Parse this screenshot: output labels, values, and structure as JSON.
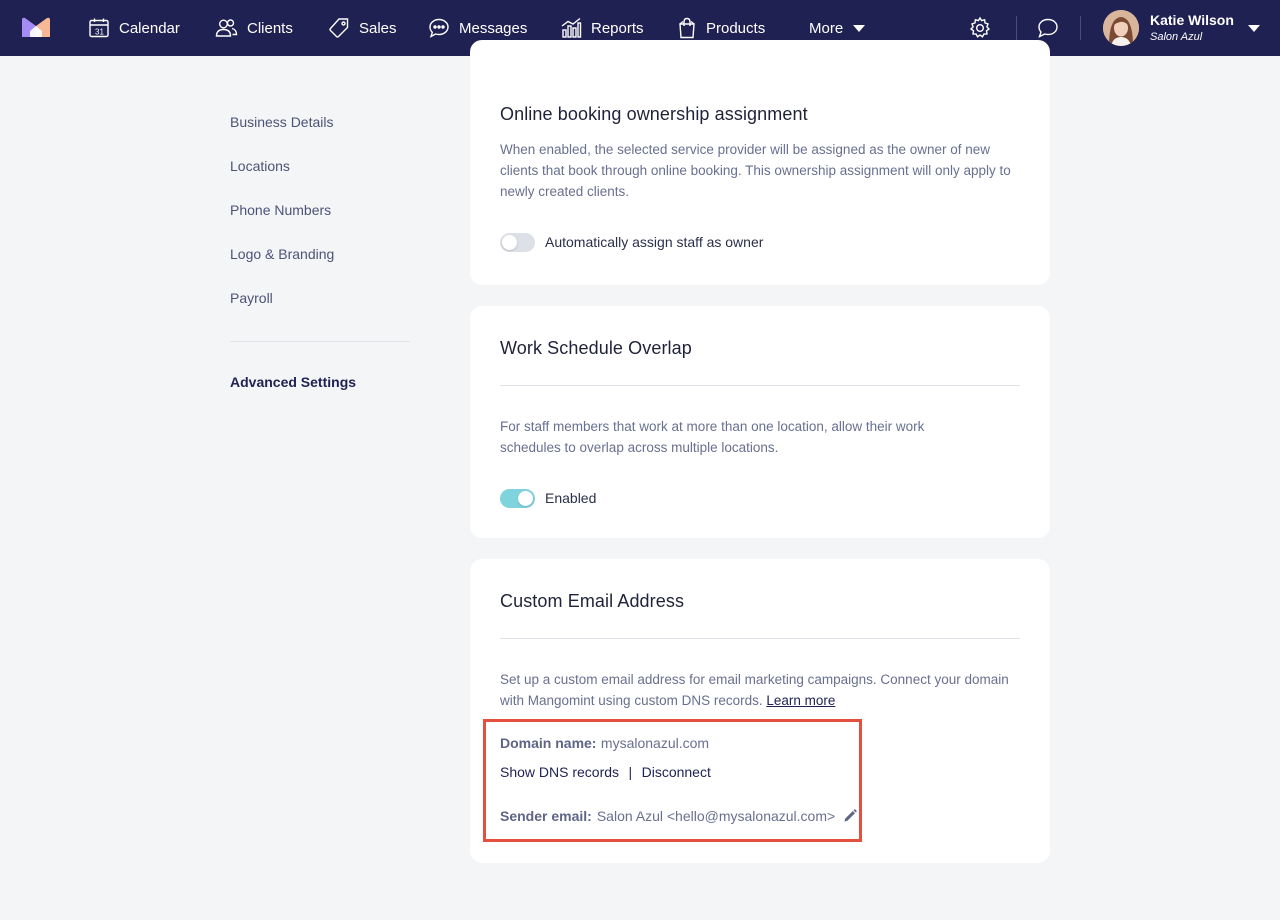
{
  "nav": {
    "items": [
      {
        "label": "Calendar",
        "icon": "calendar-icon"
      },
      {
        "label": "Clients",
        "icon": "clients-icon"
      },
      {
        "label": "Sales",
        "icon": "tag-icon"
      },
      {
        "label": "Messages",
        "icon": "chat-bubble-icon"
      },
      {
        "label": "Reports",
        "icon": "bar-chart-icon"
      },
      {
        "label": "Products",
        "icon": "shopping-bag-icon"
      }
    ],
    "more_label": "More",
    "user": {
      "name": "Katie Wilson",
      "salon": "Salon Azul"
    },
    "brand_colors": {
      "nav_bg": "#1f2152",
      "logo_purple": "#a58cf5",
      "logo_peach": "#f7b896"
    }
  },
  "sidebar": {
    "items": [
      "Business Details",
      "Locations",
      "Phone Numbers",
      "Logo & Branding",
      "Payroll"
    ],
    "active": "Advanced Settings"
  },
  "booking_ownership": {
    "title": "Online booking ownership assignment",
    "description": "When enabled, the selected service provider will be assigned as the owner of new clients that book through online booking. This ownership assignment will only apply to newly created clients.",
    "toggle_label": "Automatically assign staff as owner",
    "toggle_on": false
  },
  "work_schedule": {
    "title": "Work Schedule Overlap",
    "description": "For staff members that work at more than one location, allow their work schedules to overlap across multiple locations.",
    "toggle_label": "Enabled",
    "toggle_on": true
  },
  "custom_email": {
    "title": "Custom Email Address",
    "description": "Set up a custom email address for email marketing campaigns. Connect your domain with Mangomint using custom DNS records.",
    "learn_more": "Learn more",
    "domain_label": "Domain name:",
    "domain_value": "mysalonazul.com",
    "show_dns": "Show DNS records",
    "separator": "|",
    "disconnect": "Disconnect",
    "sender_label": "Sender email:",
    "sender_value": "Salon Azul <hello@mysalonazul.com>"
  }
}
